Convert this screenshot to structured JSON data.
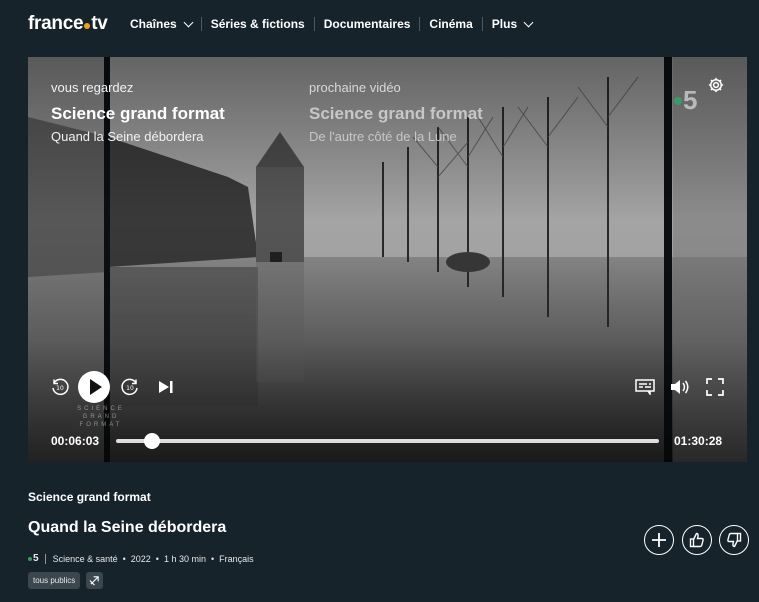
{
  "brand": {
    "part1": "france",
    "part2": "tv"
  },
  "nav": {
    "items": [
      {
        "label": "Chaînes",
        "dropdown": true
      },
      {
        "label": "Séries & fictions",
        "dropdown": false
      },
      {
        "label": "Documentaires",
        "dropdown": false
      },
      {
        "label": "Cinéma",
        "dropdown": false
      },
      {
        "label": "Plus",
        "dropdown": true
      }
    ]
  },
  "player": {
    "now_label": "vous regardez",
    "now_title": "Science grand format",
    "now_subtitle": "Quand la Seine débordera",
    "next_label": "prochaine vidéo",
    "next_title": "Science grand format",
    "next_subtitle": "De l'autre côté de la Lune",
    "channel_logo": "5",
    "rewind_seconds": "10",
    "forward_seconds": "10",
    "watermark": [
      "SCIENCE",
      "GRAND",
      "FORMAT"
    ],
    "current_time": "00:06:03",
    "total_time": "01:30:28",
    "progress_fraction": 0.067
  },
  "info": {
    "program": "Science grand format",
    "episode_title": "Quand la Seine débordera",
    "channel": "5",
    "genre": "Science & santé",
    "year": "2022",
    "duration": "1 h 30 min",
    "language": "Français",
    "rating_badge": "tous publics"
  },
  "icons": {
    "settings": "gear-icon",
    "subtitles": "subtitles-icon",
    "volume": "volume-icon",
    "fullscreen": "fullscreen-icon",
    "add": "plus-icon",
    "like": "thumbs-up-icon",
    "dislike": "thumbs-down-icon",
    "audio_description": "audio-description-icon"
  },
  "colors": {
    "background": "#16232b",
    "brand_dot": "#f0a020",
    "channel_green": "#3b9a6a"
  }
}
